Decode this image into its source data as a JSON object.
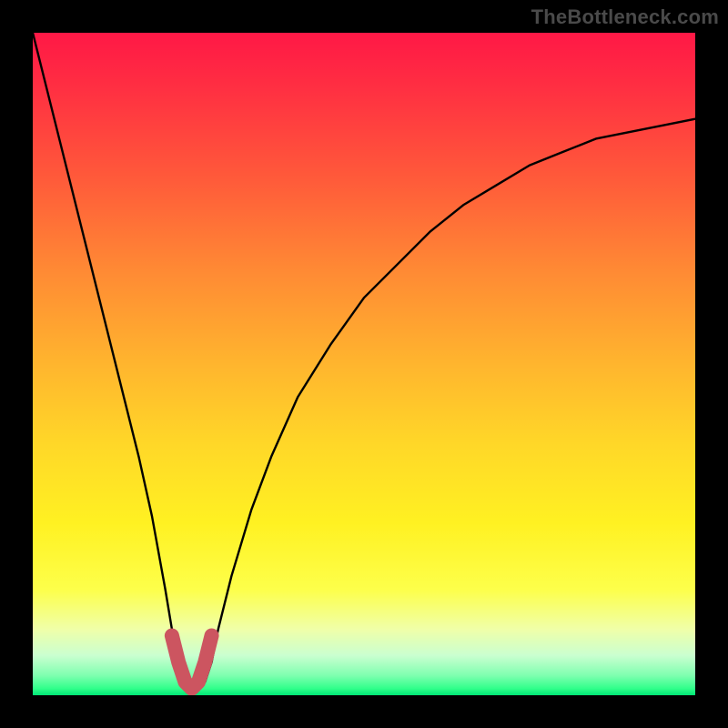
{
  "watermark": {
    "text": "TheBottleneck.com"
  },
  "chart_data": {
    "type": "line",
    "title": "",
    "xlabel": "",
    "ylabel": "",
    "xlim": [
      0,
      100
    ],
    "ylim": [
      0,
      100
    ],
    "series": [
      {
        "name": "bottleneck-curve",
        "x": [
          0,
          2,
          4,
          6,
          8,
          10,
          12,
          14,
          16,
          18,
          20,
          21,
          22,
          23,
          24,
          25,
          26,
          27,
          28,
          30,
          33,
          36,
          40,
          45,
          50,
          55,
          60,
          65,
          70,
          75,
          80,
          85,
          90,
          95,
          100
        ],
        "values": [
          100,
          92,
          84,
          76,
          68,
          60,
          52,
          44,
          36,
          27,
          16,
          10,
          5,
          2,
          1,
          1,
          2,
          5,
          10,
          18,
          28,
          36,
          45,
          53,
          60,
          65,
          70,
          74,
          77,
          80,
          82,
          84,
          85,
          86,
          87
        ]
      }
    ],
    "highlight": {
      "name": "minimum-marker",
      "x": [
        21,
        22,
        23,
        24,
        25,
        26,
        27
      ],
      "values": [
        9,
        5,
        2,
        1,
        2,
        5,
        9
      ],
      "color": "#cc5560"
    },
    "gradient_stops": [
      {
        "pos": 0.0,
        "color": "#ff1846"
      },
      {
        "pos": 0.5,
        "color": "#ffb52e"
      },
      {
        "pos": 0.84,
        "color": "#fdff4a"
      },
      {
        "pos": 1.0,
        "color": "#00e676"
      }
    ]
  }
}
